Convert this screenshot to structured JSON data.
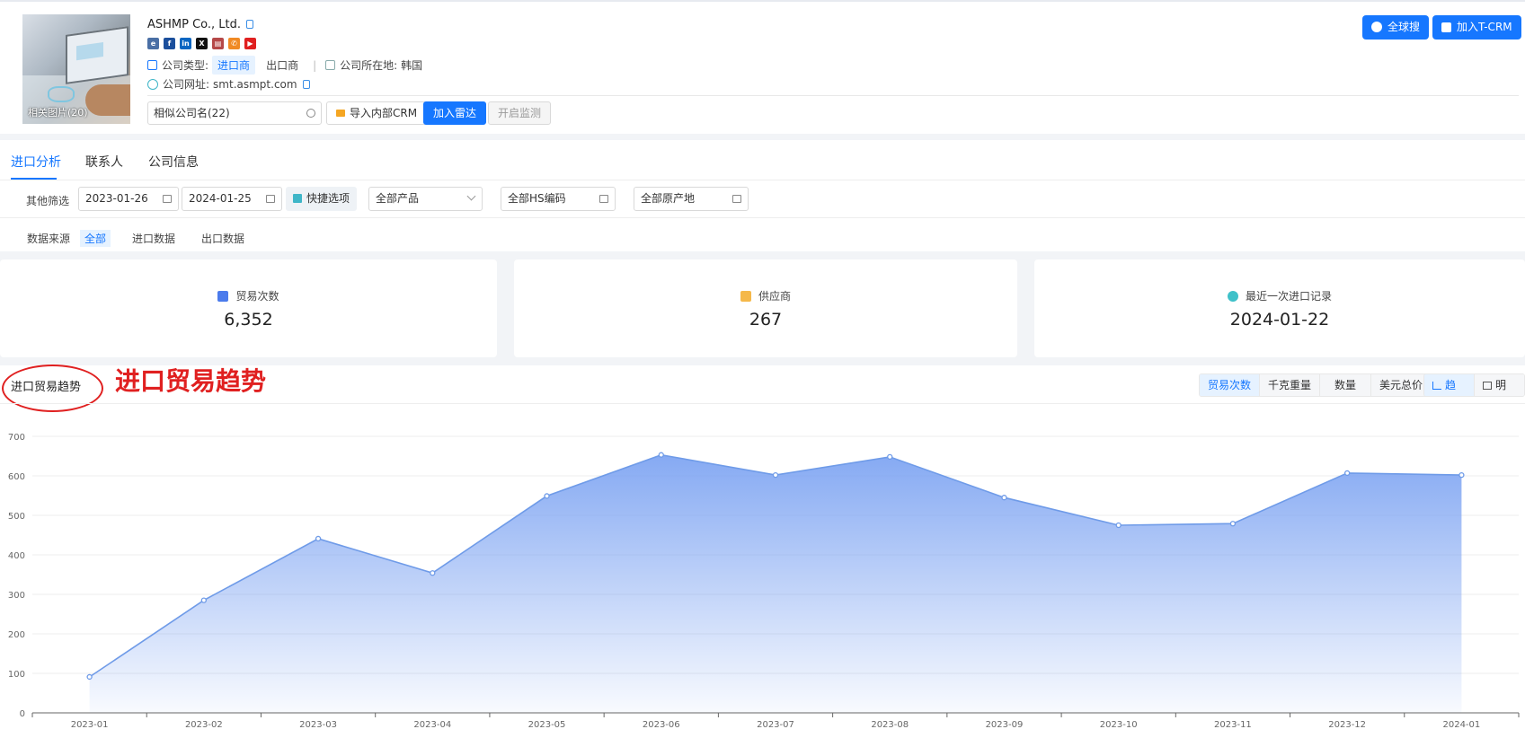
{
  "company": {
    "name": "ASHMP Co., Ltd.",
    "photo_label": "相关图片(20)",
    "type_label": "公司类型:",
    "type_active": "进口商",
    "type_other": "出口商",
    "location_label": "公司所在地:",
    "location_value": "韩国",
    "website_label": "公司网址:",
    "website_value": "smt.asmpt.com",
    "socials": [
      "edge-icon",
      "facebook-icon",
      "linkedin-icon",
      "x-icon",
      "printer-icon",
      "phone-icon",
      "youtube-icon"
    ]
  },
  "actions": {
    "similar_input": "相似公司名(22)",
    "import_crm": "导入内部CRM",
    "add_radar": "加入雷达",
    "monitor": "开启监测",
    "global_search": "全球搜",
    "add_tcrm": "加入T-CRM"
  },
  "tabs": [
    "进口分析",
    "联系人",
    "公司信息"
  ],
  "filters": {
    "label": "其他筛选",
    "date_from": "2023-01-26",
    "date_to": "2024-01-25",
    "quick": "快捷选项",
    "product": "全部产品",
    "hs": "全部HS编码",
    "origin": "全部原产地"
  },
  "sources": {
    "label": "数据来源",
    "items": [
      "全部",
      "进口数据",
      "出口数据"
    ]
  },
  "stats": [
    {
      "label": "贸易次数",
      "value": "6,352"
    },
    {
      "label": "供应商",
      "value": "267"
    },
    {
      "label": "最近一次进口记录",
      "value": "2024-01-22"
    }
  ],
  "chart_section": {
    "title": "进口贸易趋势",
    "annotation": "进口贸易趋势",
    "metric_tabs": [
      "贸易次数",
      "千克重量",
      "数量",
      "美元总价"
    ],
    "view_tabs": [
      "趋势",
      "明细"
    ]
  },
  "colors": {
    "primary": "#1677ff",
    "annotation_red": "#e02020",
    "series_line": "#6f9be8",
    "area_top": "#7fa5f2"
  },
  "chart_data": {
    "type": "area",
    "categories": [
      "2023-01",
      "2023-02",
      "2023-03",
      "2023-04",
      "2023-05",
      "2023-06",
      "2023-07",
      "2023-08",
      "2023-09",
      "2023-10",
      "2023-11",
      "2023-12",
      "2024-01"
    ],
    "values": [
      91,
      285,
      441,
      354,
      549,
      653,
      602,
      648,
      545,
      475,
      479,
      607,
      602
    ],
    "yticks": [
      0,
      100,
      200,
      300,
      400,
      500,
      600,
      700
    ],
    "ylim": [
      0,
      700
    ],
    "grid": true
  }
}
